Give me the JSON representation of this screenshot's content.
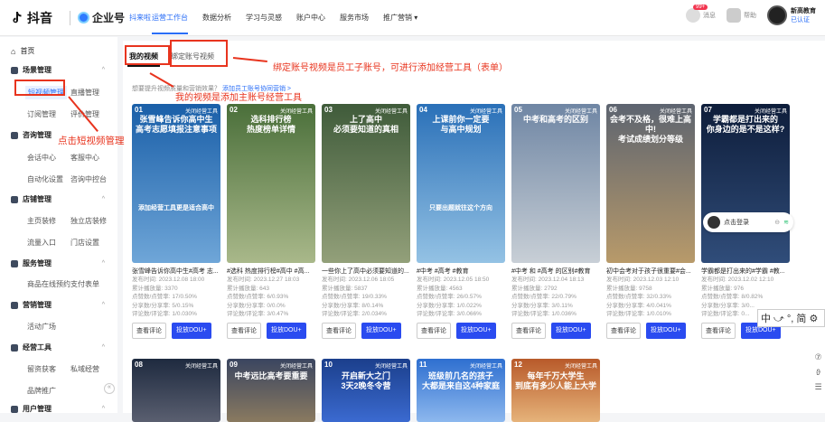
{
  "topbar": {
    "brand": "抖音",
    "enterprise": "企业号",
    "enterprise_sub": "抖来啦",
    "nav": [
      "运营工作台",
      "数据分析",
      "学习与灵感",
      "账户中心",
      "服务市场",
      "推广营销 ▾"
    ],
    "msg_badge": "99+",
    "msg_label": "消息",
    "help_label": "帮助",
    "profile_name": "新高教育",
    "profile_status": "已认证"
  },
  "sidebar": {
    "home": "首页",
    "groups": [
      {
        "label": "场景管理"
      },
      {
        "label": "咨询管理"
      },
      {
        "label": "店铺管理"
      },
      {
        "label": "服务管理"
      },
      {
        "label": "营销管理"
      },
      {
        "label": "经营工具"
      },
      {
        "label": "用户管理"
      }
    ],
    "items": {
      "short_video": "短视频管理",
      "live": "直播管理",
      "order": "订阅管理",
      "evaluate": "评价管理",
      "chat": "会话中心",
      "kefu": "客服中心",
      "auto": "自动化设置",
      "console": "咨询中控台",
      "home_deco": "主页装修",
      "shop": "独立店装修",
      "flow": "流量入口",
      "store": "门店设置",
      "booking": "商品在线预约",
      "pay": "支付表单",
      "campaign": "活动广场",
      "leads": "留资获客",
      "private": "私域经营",
      "brand_ad": "品牌推广"
    },
    "collapse": "«"
  },
  "main": {
    "tab_active": "我的视频",
    "tab_bind": "绑定账号视频",
    "hint_text": "想要提升视频质量和营销效果？",
    "hint_link": "添加员工账号协同营销 >"
  },
  "annotations": {
    "a1": "绑定账号视频是员工子账号，可进行添加经营工具（表单）",
    "a2": "我的视频是添加主账号经营工具",
    "a3": "点击短视频管理"
  },
  "buttons": {
    "comment": "查看评论",
    "promote": "投放DOU+"
  },
  "cards": [
    {
      "num": "01",
      "tag": "关闭经营工具",
      "cap": "张雪峰告诉你高中生\n高考志愿填报注意事项",
      "bot": "添加经营工具更是适合高中",
      "title": "张雪峰告诉你高中生#高考 志...",
      "date": "发布时间: 2023.12.08 18:00",
      "play": "累计播放量: 3370",
      "like": "点赞数/点赞率: 17/0.50%",
      "share": "分享数/分享率: 5/0.15%",
      "cmt": "评论数/评论率: 1/0.030%",
      "c1": "#1a5fa8",
      "c2": "#6fa6d8"
    },
    {
      "num": "02",
      "tag": "关闭经营工具",
      "cap": "选科排行榜\n热度榜单详情",
      "bot": "",
      "title": "#选科 热度排行榜#高中 #高...",
      "date": "发布时间: 2023.12.27 18:03",
      "play": "累计播放量: 643",
      "like": "点赞数/点赞率: 6/0.93%",
      "share": "分享数/分享率: 0/0.0%",
      "cmt": "评论数/评论率: 3/0.47%",
      "c1": "#4a6f3a",
      "c2": "#a9b88a"
    },
    {
      "num": "03",
      "tag": "关闭经营工具",
      "cap": "上了高中\n必须要知道的真相",
      "bot": "",
      "title": "一些你上了高中必须要知道的...",
      "date": "发布时间: 2023.12.06 18:05",
      "play": "累计播放量: 5837",
      "like": "点赞数/点赞率: 19/0.33%",
      "share": "分享数/分享率: 8/0.14%",
      "cmt": "评论数/评论率: 2/0.034%",
      "c1": "#3f5b3a",
      "c2": "#93a07a"
    },
    {
      "num": "04",
      "tag": "关闭经营工具",
      "cap": "上课前你一定要\n与高中规划",
      "bot": "只要出题就往这个方向",
      "title": "#中考 #高考 #教育",
      "date": "发布时间: 2023.12.05 18:50",
      "play": "累计播放量: 4563",
      "like": "点赞数/点赞率: 26/0.57%",
      "share": "分享数/分享率: 1/0.022%",
      "cmt": "评论数/评论率: 3/0.066%",
      "c1": "#2a70b8",
      "c2": "#94c2e4"
    },
    {
      "num": "05",
      "tag": "关闭经营工具",
      "cap": "中考和高考的区别",
      "bot": "",
      "title": "#中考 和 #高考 的区别#教育",
      "date": "发布时间: 2023.12.04 18:13",
      "play": "累计播放量: 2792",
      "like": "点赞数/点赞率: 22/0.79%",
      "share": "分享数/分享率: 3/0.11%",
      "cmt": "评论数/评论率: 1/0.036%",
      "c1": "#6f86a4",
      "c2": "#c8cfd6"
    },
    {
      "num": "06",
      "tag": "关闭经营工具",
      "cap": "会考不及格，很难上高中!\n考试成绩划分等级",
      "bot": "",
      "title": "初中会考对于孩子很重要#会...",
      "date": "发布时间: 2023.12.03 12:10",
      "play": "累计播放量: 9758",
      "like": "点赞数/点赞率: 32/0.33%",
      "share": "分享数/分享率: 4/0.041%",
      "cmt": "评论数/评论率: 1/0.010%",
      "c1": "#5d6470",
      "c2": "#b89a6a"
    },
    {
      "num": "07",
      "tag": "关闭经营工具",
      "cap": "学霸都是打出来的\n你身边的是不是这样?",
      "bot": "",
      "title": "学霸都是打出来的#学霸 #教...",
      "date": "发布时间: 2023.12.02 12:10",
      "play": "累计播放量: 976",
      "like": "点赞数/点赞率: 8/0.82%",
      "share": "分享数/分享率: 3/0...",
      "cmt": "评论数/评论率: 0...",
      "c1": "#0e1d3a",
      "c2": "#304d7a"
    }
  ],
  "cards_row2": [
    {
      "num": "08",
      "tag": "关闭经营工具",
      "cap": "",
      "c1": "#1e2a3f",
      "c2": "#5a5f70"
    },
    {
      "num": "09",
      "tag": "关闭经营工具",
      "cap": "中考远比高考要重要",
      "c1": "#3a4560",
      "c2": "#8a7a60"
    },
    {
      "num": "10",
      "tag": "关闭经营工具",
      "cap": "开启新大之门\n3天2晚冬令营",
      "c1": "#1b3f8c",
      "c2": "#3b6ad0"
    },
    {
      "num": "11",
      "tag": "关闭经营工具",
      "cap": "班级前几名的孩子\n大都是来自这4种家庭",
      "c1": "#2e6fd0",
      "c2": "#8db8ee"
    },
    {
      "num": "12",
      "tag": "关闭经营工具",
      "cap": "每年千万大学生\n到底有多少人能上大学",
      "c1": "#b85a2a",
      "c2": "#e6b37a"
    }
  ],
  "widget": {
    "label": "点击登录"
  },
  "ime": {
    "text": "中 ⤻ °, 简 ⚙"
  },
  "rightbar": [
    "⑦",
    "ϑ",
    "☰"
  ]
}
